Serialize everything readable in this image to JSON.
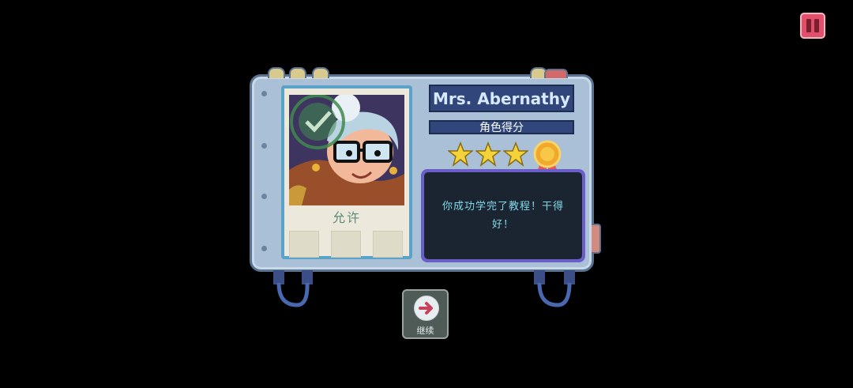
{
  "character": {
    "name": "Mrs. Abernathy",
    "score_label": "角色得分",
    "approval_label": "允许",
    "rating": 3,
    "max_rating": 3,
    "has_medal": true
  },
  "message": {
    "text": "你成功学完了教程！干得好！"
  },
  "continue_button": {
    "label": "继续"
  },
  "colors": {
    "background": "#000000",
    "console": "#a9c0d6",
    "banner": "#31467a",
    "message_text": "#7fd8e8",
    "star": "#f3d23a",
    "pause": "#e24f6a"
  }
}
